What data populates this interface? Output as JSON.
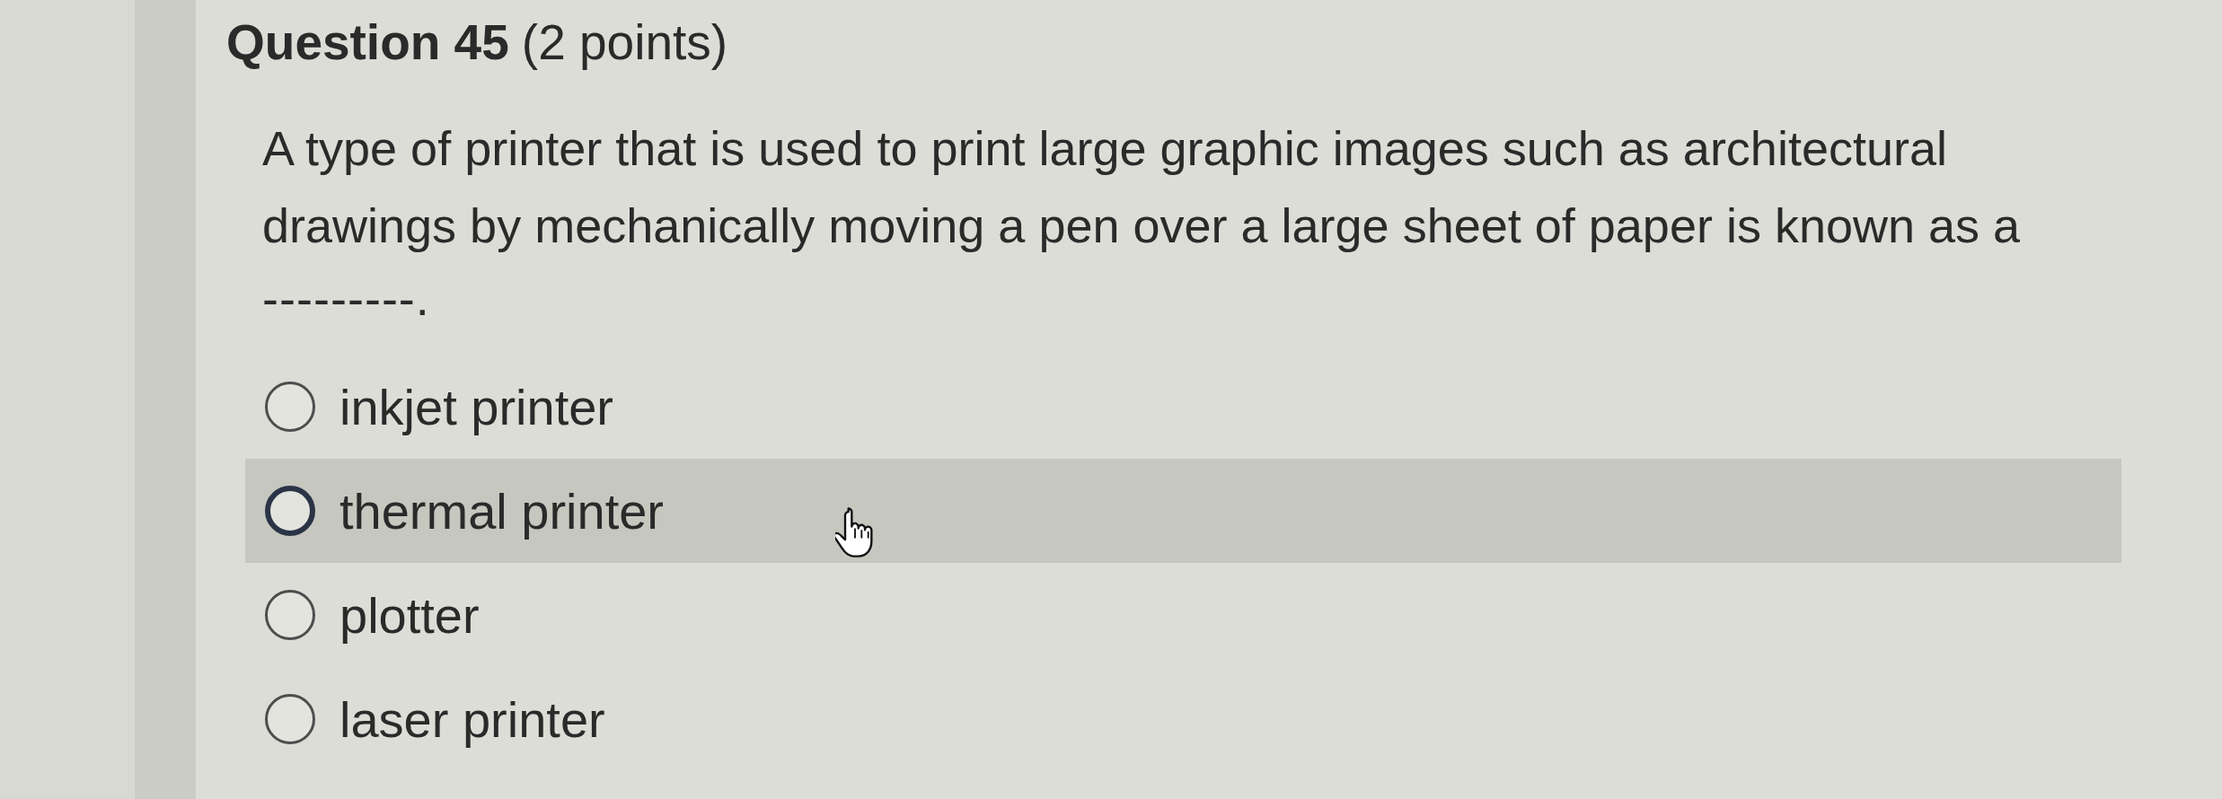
{
  "question": {
    "title": "Question 45",
    "points": "(2 points)",
    "text": "A type of printer that is used to print large graphic images such as architectural drawings by mechanically moving a pen over a large sheet of paper is known as a",
    "blank": "---------."
  },
  "options": [
    {
      "label": "inkjet printer",
      "selected": false,
      "hovered": false
    },
    {
      "label": "thermal printer",
      "selected": false,
      "hovered": true
    },
    {
      "label": "plotter",
      "selected": false,
      "hovered": false
    },
    {
      "label": "laser printer",
      "selected": false,
      "hovered": false
    }
  ]
}
